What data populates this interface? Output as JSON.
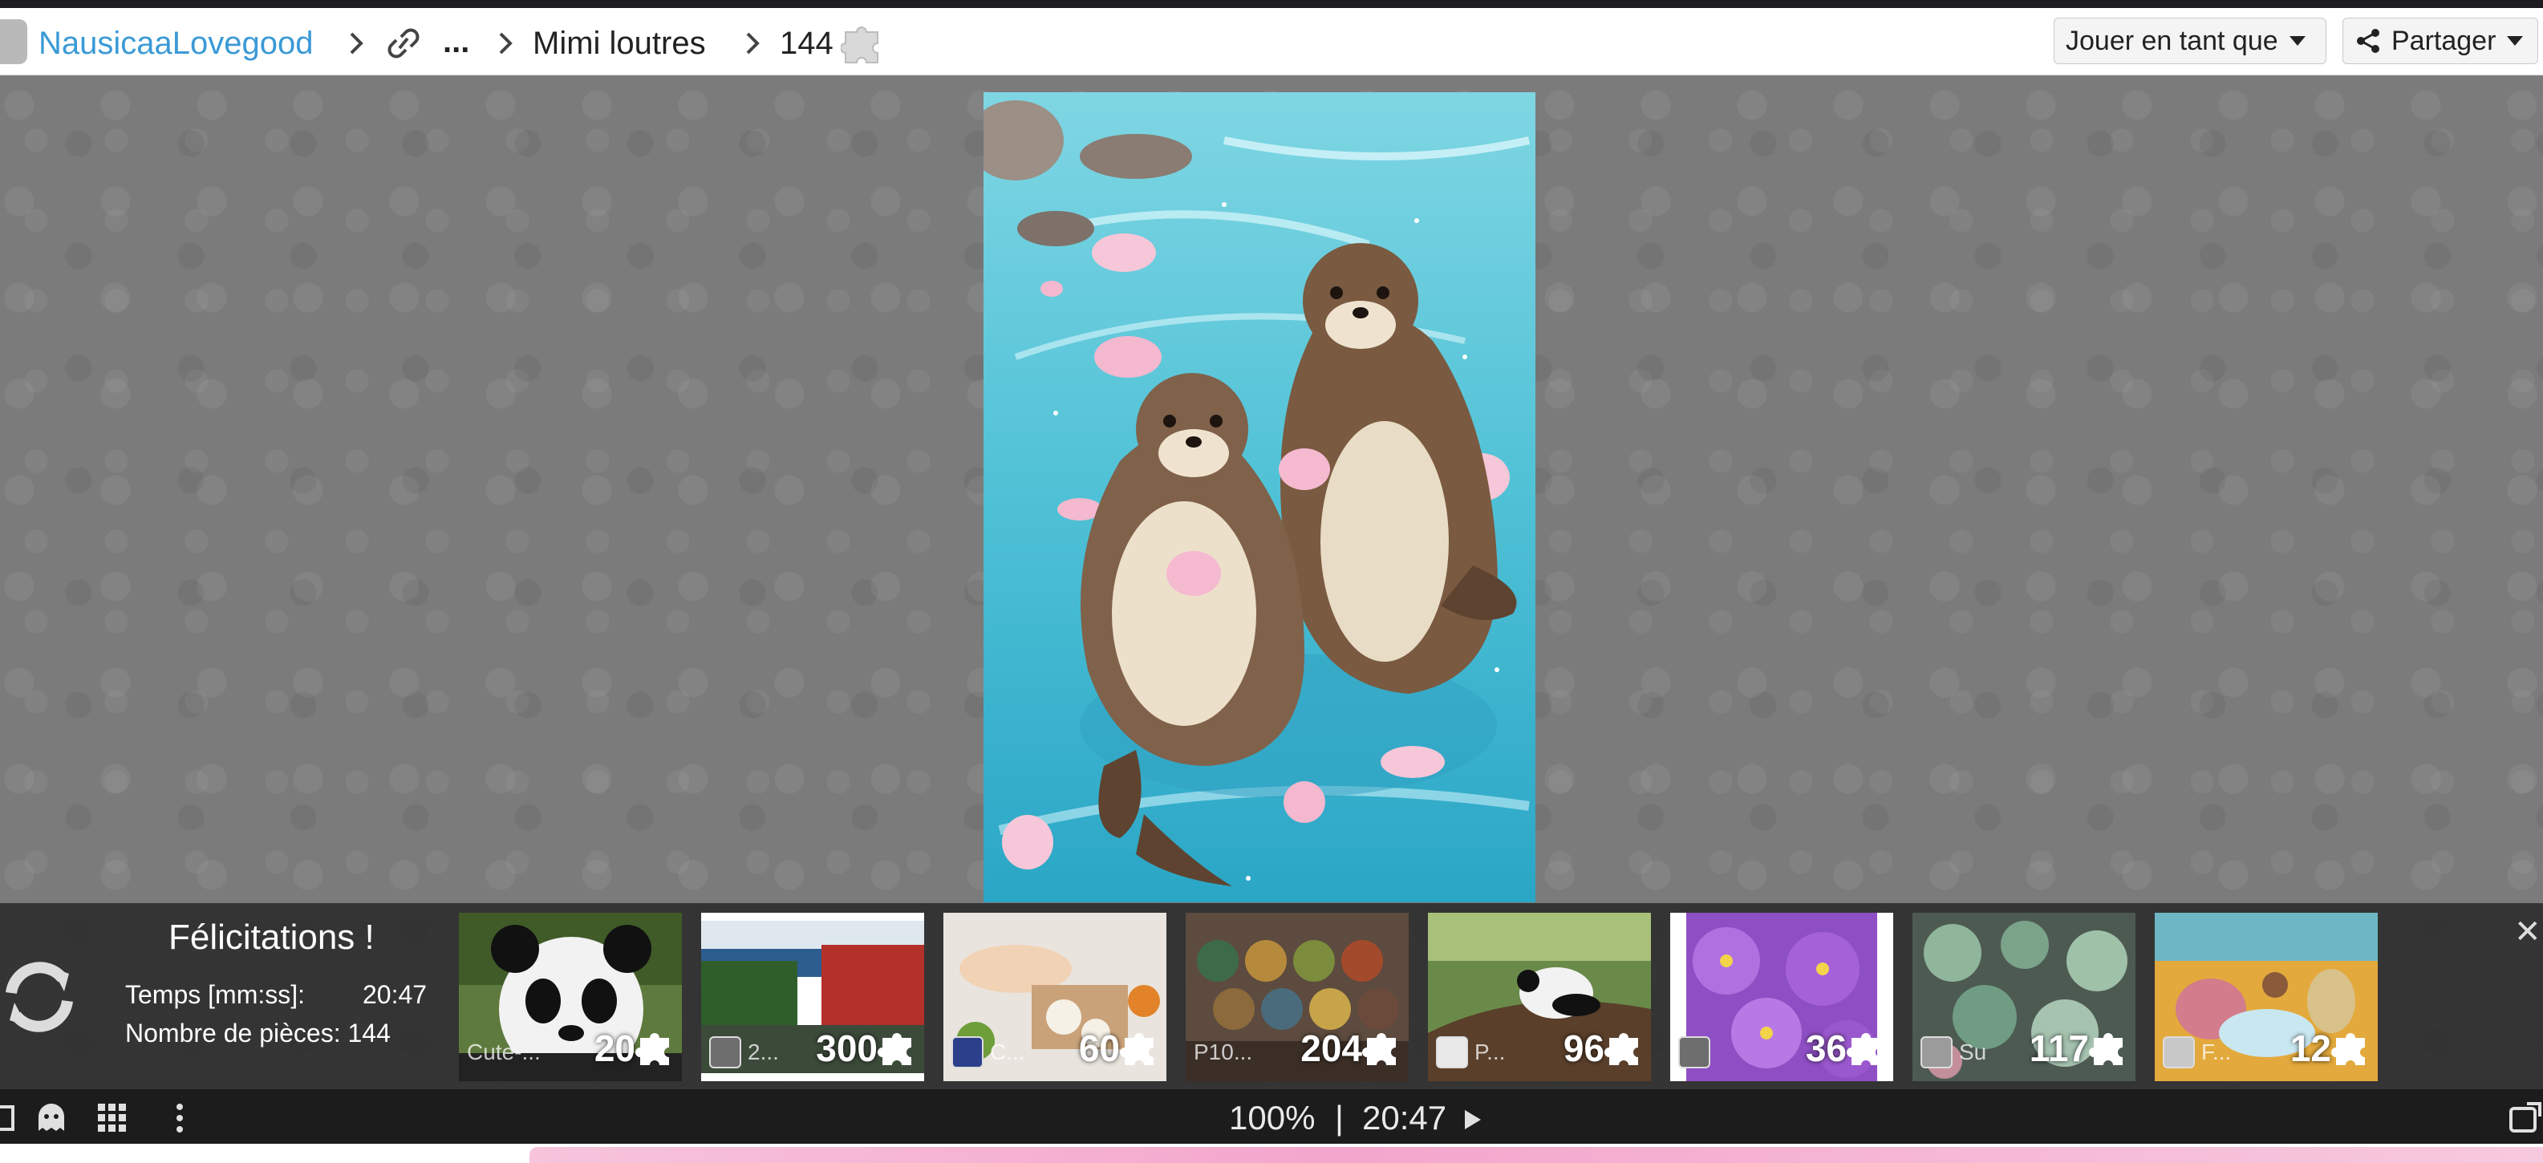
{
  "breadcrumb": {
    "user": "NausicaaLovegood",
    "ellipsis": "...",
    "title": "Mimi loutres",
    "count": "144"
  },
  "header_buttons": {
    "play_as": "Jouer en tant que",
    "share": "Partager"
  },
  "congrats": {
    "title": "Félicitations !",
    "time_label": "Temps [mm:ss]:",
    "time_value": "20:47",
    "pieces_label": "Nombre de pièces: 144"
  },
  "suggestions": [
    {
      "owner": "Cute-...",
      "count": "20"
    },
    {
      "owner": "2...",
      "count": "300"
    },
    {
      "owner": "C...",
      "count": "60"
    },
    {
      "owner": "P10...",
      "count": "204"
    },
    {
      "owner": "P...",
      "count": "96"
    },
    {
      "owner": "",
      "count": "36"
    },
    {
      "owner": "Su",
      "count": "117"
    },
    {
      "owner": "F...",
      "count": "12"
    }
  ],
  "statusbar": {
    "zoom": "100%",
    "separator": "|",
    "timer": "20:47"
  },
  "icons": [
    "link-icon",
    "share-icon",
    "refresh-icon",
    "close-icon",
    "puzzle-piece-icon",
    "grid-icon",
    "more-icon",
    "play-icon",
    "fullscreen-icon"
  ],
  "colors": {
    "accent": "#3b9ad6",
    "panel": "#282828",
    "pink": "#f4a6cc"
  }
}
